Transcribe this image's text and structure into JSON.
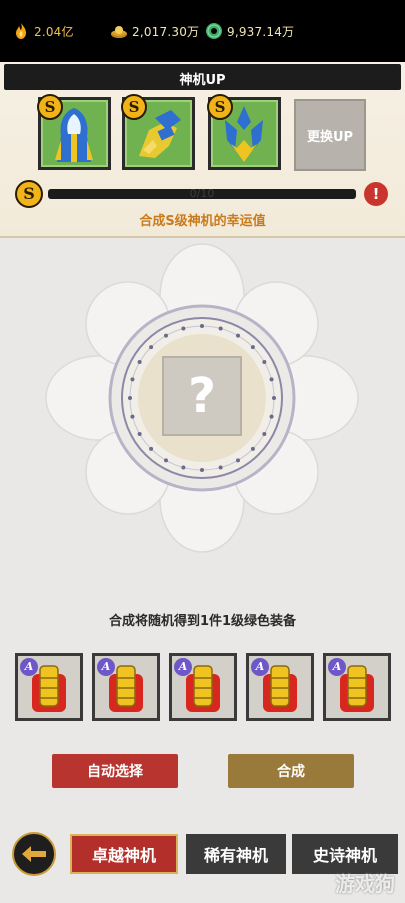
{
  "resources": [
    {
      "icon": "flame-icon",
      "value": "2.04亿"
    },
    {
      "icon": "gold-ingot-icon",
      "value": "2,017.30万"
    },
    {
      "icon": "jade-coin-icon",
      "value": "9,937.14万"
    }
  ],
  "up_panel": {
    "title": "神机UP",
    "swap_label": "更换UP",
    "progress_text": "0/10",
    "progress_fraction": 0,
    "luck_label": "合成S级神机的幸运值",
    "grade_badge": "S"
  },
  "center": {
    "placeholder": "?",
    "description": "合成将随机得到1件1级绿色装备"
  },
  "slot_badge": "A",
  "buttons": {
    "auto_select": "自动选择",
    "synthesize": "合成"
  },
  "tabs": [
    "卓越神机",
    "稀有神机",
    "史诗神机"
  ],
  "watermark": "游戏狗",
  "colors": {
    "top_bar": "#000000",
    "panel_bg": "#f6f0e4",
    "card_green": "#6fb24f",
    "s_badge": "#f0b31a",
    "a_badge": "#6e58c8",
    "auto_btn": "#b8352f",
    "synth_btn": "#9a7a3a",
    "active_tab": "#b32f2a",
    "tab": "#3a3a3a"
  }
}
